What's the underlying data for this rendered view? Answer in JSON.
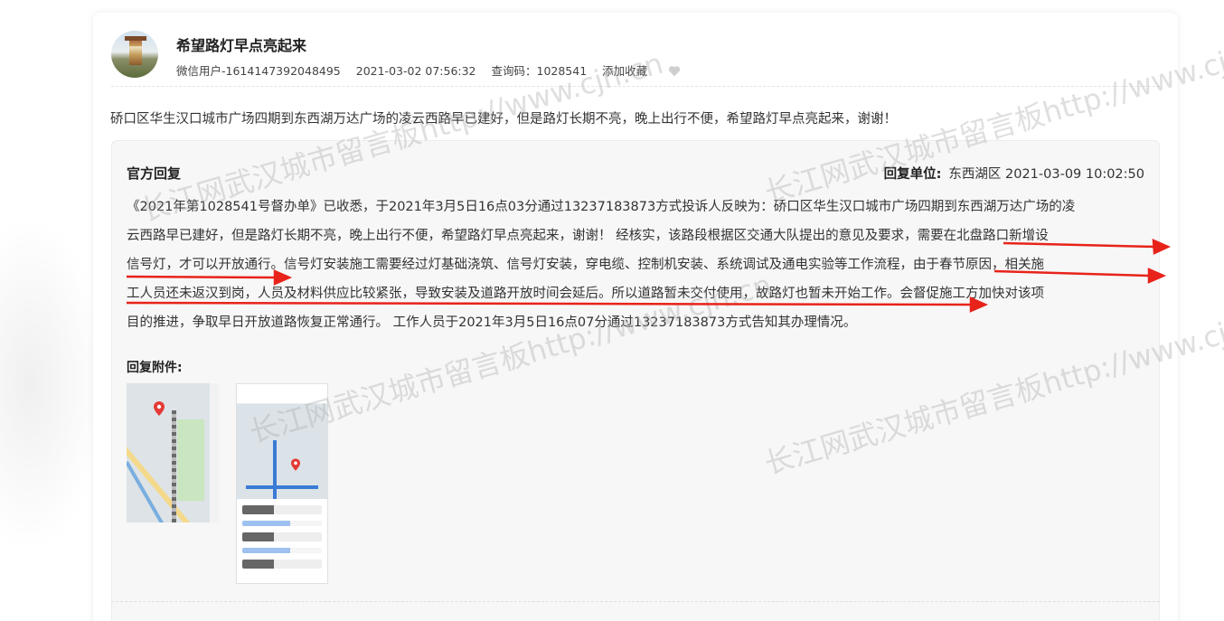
{
  "post": {
    "title": "希望路灯早点亮起来",
    "user": "微信用户-1614147392048495",
    "datetime": "2021-03-02 07:56:32",
    "query_code": "查询码：1028541",
    "favorite_label": "添加收藏",
    "content": "硚口区华生汉口城市广场四期到东西湖万达广场的凌云西路早已建好，但是路灯长期不亮，晚上出行不便，希望路灯早点亮起来，谢谢！"
  },
  "reply": {
    "title": "官方回复",
    "unit_label": "回复单位:",
    "unit_value": "东西湖区 2021-03-09 10:02:50",
    "lines": [
      "《2021年第1028541号督办单》已收悉，于2021年3月5日16点03分通过13237183873方式投诉人反映为：硚口区华生汉口城市广场四期到东西湖万达广场的凌",
      "云西路早已建好，但是路灯长期不亮，晚上出行不便，希望路灯早点亮起来，谢谢！ 经核实，该路段根据区交通大队提出的意见及要求，需要在北盘路口新增设",
      "信号灯，才可以开放通行。信号灯安装施工需要经过灯基础浇筑、信号灯安装，穿电缆、控制机安装、系统调试及通电实验等工作流程，由于春节原因，相关施",
      "工人员还未返汉到岗，人员及材料供应比较紧张，导致安装及道路开放时间会延后。所以道路暂未交付使用，故路灯也暂未开始工作。会督促施工方加快对该项",
      "目的推进，争取早日开放道路恢复正常通行。 工作人员于2021年3月5日16点07分通过13237183873方式告知其办理情况。"
    ],
    "attachments_label": "回复附件:"
  },
  "watermark": {
    "text": "长江网武汉城市留言板http://www.cjn.cn",
    "color": "#aaaaaa"
  },
  "colors": {
    "annotation_red": "#e8231a",
    "card_bg": "#ffffff",
    "reply_bg": "#f7f7f7"
  },
  "icons": [
    "user-avatar",
    "heart-icon",
    "map-pin-icon"
  ]
}
